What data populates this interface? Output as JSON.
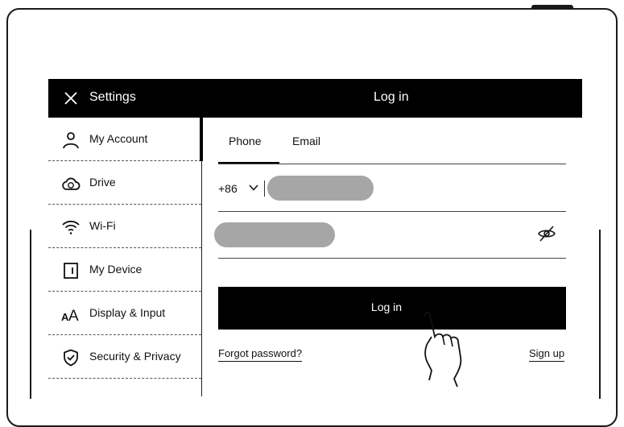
{
  "header": {
    "settings_title": "Settings",
    "page_title": "Log in"
  },
  "sidebar": {
    "items": [
      {
        "label": "My Account",
        "icon": "user-icon"
      },
      {
        "label": "Drive",
        "icon": "cloud-icon"
      },
      {
        "label": "Wi-Fi",
        "icon": "wifi-icon"
      },
      {
        "label": "My Device",
        "icon": "device-icon"
      },
      {
        "label": "Display & Input",
        "icon": "font-size-icon"
      },
      {
        "label": "Security & Privacy",
        "icon": "shield-icon"
      }
    ],
    "active_index": 0
  },
  "login": {
    "tabs": [
      {
        "label": "Phone",
        "selected": true
      },
      {
        "label": "Email",
        "selected": false
      }
    ],
    "country_code": "+86",
    "phone_value_redacted": true,
    "password_value_redacted": true,
    "submit_label": "Log in",
    "forgot_label": "Forgot password?",
    "signup_label": "Sign up"
  },
  "colors": {
    "background": "#ffffff",
    "titlebar": "#000000",
    "button": "#000000",
    "redaction": "#a6a6a6"
  }
}
